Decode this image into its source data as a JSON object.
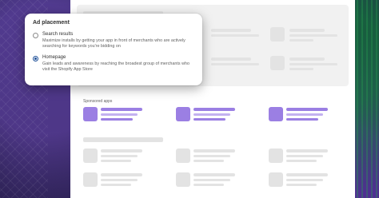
{
  "popover": {
    "title": "Ad placement",
    "options": [
      {
        "label": "Search results",
        "description": "Maximize installs by getting your app in front of merchants who are actively searching for keywords you're bidding on",
        "selected": false
      },
      {
        "label": "Homepage",
        "description": "Gain leads and awareness by reaching the broadest group of merchants who visit the Shopify App Store",
        "selected": true
      }
    ]
  },
  "page": {
    "sponsored_heading": "Sponsored apps"
  },
  "colors": {
    "accent_purple": "#9b7fe3",
    "radio_selected": "#1f5199",
    "placeholder_gray": "#e3e3e3"
  }
}
